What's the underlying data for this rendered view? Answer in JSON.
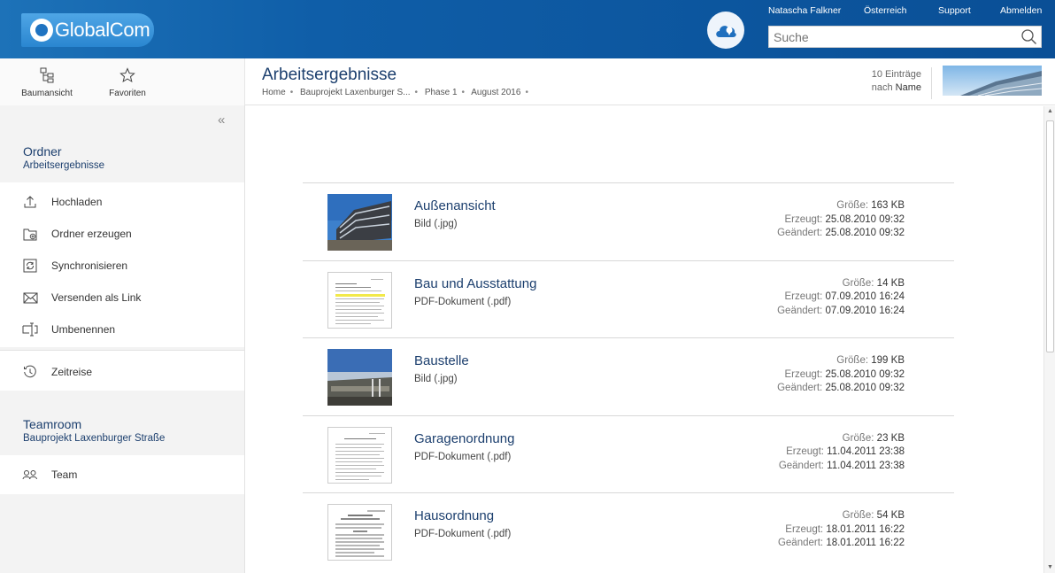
{
  "header": {
    "logo_text": "GlobalCom",
    "user": "Natascha Falkner",
    "country": "Österreich",
    "support": "Support",
    "logout": "Abmelden",
    "search_placeholder": "Suche"
  },
  "toolbar": {
    "tree_label": "Baumansicht",
    "favorites_label": "Favoriten"
  },
  "page": {
    "title": "Arbeitsergebnisse",
    "breadcrumb": [
      "Home",
      "Bauprojekt Laxenburger S...",
      "Phase 1",
      "August 2016"
    ],
    "count": "10 Einträge",
    "sort_prefix": "nach",
    "sort_key": "Name"
  },
  "sidebar": {
    "folder_title": "Ordner",
    "folder_name": "Arbeitsergebnisse",
    "actions": [
      {
        "label": "Hochladen",
        "icon": "upload-icon"
      },
      {
        "label": "Ordner erzeugen",
        "icon": "folder-add-icon"
      },
      {
        "label": "Synchronisieren",
        "icon": "sync-icon"
      },
      {
        "label": "Versenden als Link",
        "icon": "mail-icon"
      },
      {
        "label": "Umbenennen",
        "icon": "rename-icon"
      }
    ],
    "timetravel": "Zeitreise",
    "teamroom_title": "Teamroom",
    "teamroom_name": "Bauprojekt Laxenburger Straße",
    "team": "Team"
  },
  "labels": {
    "size": "Größe:",
    "created": "Erzeugt:",
    "modified": "Geändert:"
  },
  "files": [
    {
      "name": "Außenansicht",
      "type": "Bild (.jpg)",
      "size": "163 KB",
      "created": "25.08.2010 09:32",
      "modified": "25.08.2010 09:32",
      "thumb": "photo-building"
    },
    {
      "name": "Bau und Ausstattung",
      "type": "PDF-Dokument (.pdf)",
      "size": "14 KB",
      "created": "07.09.2010 16:24",
      "modified": "07.09.2010 16:24",
      "thumb": "document"
    },
    {
      "name": "Baustelle",
      "type": "Bild (.jpg)",
      "size": "199 KB",
      "created": "25.08.2010 09:32",
      "modified": "25.08.2010 09:32",
      "thumb": "photo-site"
    },
    {
      "name": "Garagenordnung",
      "type": "PDF-Dokument (.pdf)",
      "size": "23 KB",
      "created": "11.04.2011 23:38",
      "modified": "11.04.2011 23:38",
      "thumb": "document"
    },
    {
      "name": "Hausordnung",
      "type": "PDF-Dokument (.pdf)",
      "size": "54 KB",
      "created": "18.01.2011 16:22",
      "modified": "18.01.2011 16:22",
      "thumb": "document"
    }
  ],
  "colors": {
    "header_blue": "#0f5ea8",
    "title_blue": "#1c3f6e"
  }
}
